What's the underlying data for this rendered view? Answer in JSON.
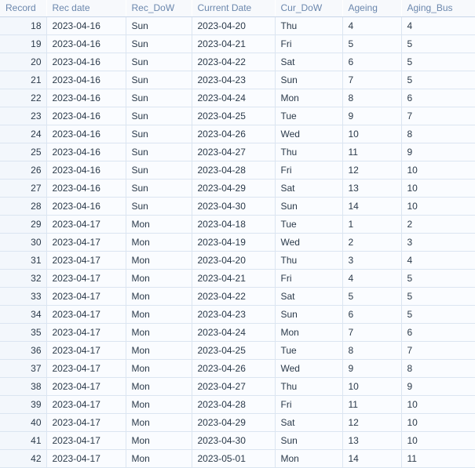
{
  "table": {
    "columns": [
      {
        "key": "record",
        "label": "Record",
        "align": "right"
      },
      {
        "key": "rec_date",
        "label": "Rec date",
        "align": "left"
      },
      {
        "key": "rec_dow",
        "label": "Rec_DoW",
        "align": "left"
      },
      {
        "key": "cur_date",
        "label": "Current Date",
        "align": "left"
      },
      {
        "key": "cur_dow",
        "label": "Cur_DoW",
        "align": "left"
      },
      {
        "key": "ageing",
        "label": "Ageing",
        "align": "left"
      },
      {
        "key": "aging_bus",
        "label": "Aging_Bus",
        "align": "left"
      }
    ],
    "rows": [
      [
        "18",
        "2023-04-16",
        "Sun",
        "2023-04-20",
        "Thu",
        "4",
        "4"
      ],
      [
        "19",
        "2023-04-16",
        "Sun",
        "2023-04-21",
        "Fri",
        "5",
        "5"
      ],
      [
        "20",
        "2023-04-16",
        "Sun",
        "2023-04-22",
        "Sat",
        "6",
        "5"
      ],
      [
        "21",
        "2023-04-16",
        "Sun",
        "2023-04-23",
        "Sun",
        "7",
        "5"
      ],
      [
        "22",
        "2023-04-16",
        "Sun",
        "2023-04-24",
        "Mon",
        "8",
        "6"
      ],
      [
        "23",
        "2023-04-16",
        "Sun",
        "2023-04-25",
        "Tue",
        "9",
        "7"
      ],
      [
        "24",
        "2023-04-16",
        "Sun",
        "2023-04-26",
        "Wed",
        "10",
        "8"
      ],
      [
        "25",
        "2023-04-16",
        "Sun",
        "2023-04-27",
        "Thu",
        "11",
        "9"
      ],
      [
        "26",
        "2023-04-16",
        "Sun",
        "2023-04-28",
        "Fri",
        "12",
        "10"
      ],
      [
        "27",
        "2023-04-16",
        "Sun",
        "2023-04-29",
        "Sat",
        "13",
        "10"
      ],
      [
        "28",
        "2023-04-16",
        "Sun",
        "2023-04-30",
        "Sun",
        "14",
        "10"
      ],
      [
        "29",
        "2023-04-17",
        "Mon",
        "2023-04-18",
        "Tue",
        "1",
        "2"
      ],
      [
        "30",
        "2023-04-17",
        "Mon",
        "2023-04-19",
        "Wed",
        "2",
        "3"
      ],
      [
        "31",
        "2023-04-17",
        "Mon",
        "2023-04-20",
        "Thu",
        "3",
        "4"
      ],
      [
        "32",
        "2023-04-17",
        "Mon",
        "2023-04-21",
        "Fri",
        "4",
        "5"
      ],
      [
        "33",
        "2023-04-17",
        "Mon",
        "2023-04-22",
        "Sat",
        "5",
        "5"
      ],
      [
        "34",
        "2023-04-17",
        "Mon",
        "2023-04-23",
        "Sun",
        "6",
        "5"
      ],
      [
        "35",
        "2023-04-17",
        "Mon",
        "2023-04-24",
        "Mon",
        "7",
        "6"
      ],
      [
        "36",
        "2023-04-17",
        "Mon",
        "2023-04-25",
        "Tue",
        "8",
        "7"
      ],
      [
        "37",
        "2023-04-17",
        "Mon",
        "2023-04-26",
        "Wed",
        "9",
        "8"
      ],
      [
        "38",
        "2023-04-17",
        "Mon",
        "2023-04-27",
        "Thu",
        "10",
        "9"
      ],
      [
        "39",
        "2023-04-17",
        "Mon",
        "2023-04-28",
        "Fri",
        "11",
        "10"
      ],
      [
        "40",
        "2023-04-17",
        "Mon",
        "2023-04-29",
        "Sat",
        "12",
        "10"
      ],
      [
        "41",
        "2023-04-17",
        "Mon",
        "2023-04-30",
        "Sun",
        "13",
        "10"
      ],
      [
        "42",
        "2023-04-17",
        "Mon",
        "2023-05-01",
        "Mon",
        "14",
        "11"
      ]
    ]
  },
  "colors": {
    "header_text": "#6b87ad",
    "cell_text": "#2b3a4a",
    "row_background": "#fafcff",
    "record_background": "#f3f7fc",
    "grid_line": "#dbe5f1",
    "header_rule": "#c8d6e8"
  }
}
